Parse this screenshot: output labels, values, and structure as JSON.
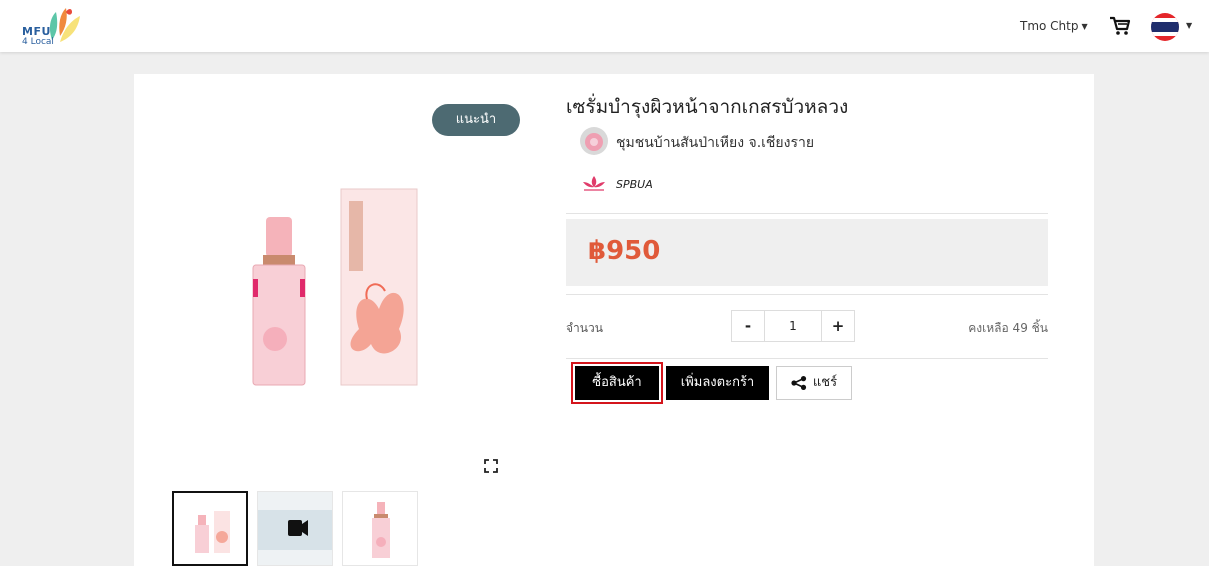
{
  "header": {
    "logo_line1": "MFU",
    "logo_line2": "4 Local",
    "user_name": "Tmo Chtp",
    "icons": [
      "logo-icon",
      "caret-down-icon",
      "cart-icon",
      "thai-flag-icon",
      "caret-down-icon"
    ],
    "flag_colors": [
      "#e4252a",
      "#ffffff",
      "#1f2d6c"
    ]
  },
  "product": {
    "badge": "แนะนำ",
    "title": "เซรั่มบำรุงผิวหน้าจากเกสรบัวหลวง",
    "seller": "ชุมชนบ้านสันป่าเหียง จ.เชียงราย",
    "brand": "SPBUA",
    "price": "฿950",
    "quantity_label": "จำนวน",
    "minus": "-",
    "quantity": "1",
    "plus": "+",
    "stock": "คงเหลือ 49 ชิ้น"
  },
  "actions": {
    "buy": "ซื้อสินค้า",
    "add_to_cart": "เพิ่มลงตะกร้า",
    "share": "แชร์"
  },
  "gallery": {
    "thumbnails": [
      "product-photo",
      "video-thumbnail",
      "bottle-photo"
    ],
    "active_index": 0
  },
  "colors": {
    "price": "#e05a3a",
    "badge": "#4d6a72",
    "buy_highlight": "#d4151c"
  }
}
